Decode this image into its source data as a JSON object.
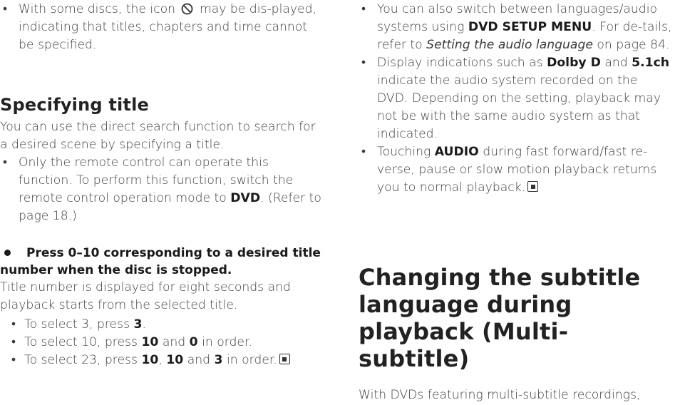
{
  "left": {
    "note_part1": "With some discs, the icon",
    "note_part2": "may be dis-played, indicating that titles, chapters and time cannot be specified.",
    "section_title": "Specifying title",
    "intro": "You can use the direct search function to search for a desired scene by specifying a title.",
    "remote_note_part1": "Only the remote control can operate this function. To perform this function, switch the remote control operation mode to",
    "remote_note_mode": "DVD",
    "remote_note_part2": ". (Refer to page 18.)",
    "step": "Press 0–10 corresponding to a desired title number when the disc is stopped.",
    "step_detail": "Title number is displayed for eight seconds and playback starts from the selected title.",
    "examples": {
      "ex1_text": "To select 3, press",
      "ex1_key": "3",
      "ex2_text": "To select 10, press",
      "ex2_key1": "10",
      "ex2_and": "and",
      "ex2_key2": "0",
      "ex2_tail": "in order.",
      "ex3_text": "To select 23, press",
      "ex3_key1": "10",
      "ex3_key2": "10",
      "ex3_and": "and",
      "ex3_key3": "3",
      "ex3_tail": "in order."
    }
  },
  "right": {
    "b1_part1": "You can also switch between languages/audio systems using",
    "b1_bold": "DVD SETUP MENU",
    "b1_part2": ". For de-tails, refer to",
    "b1_italic": "Setting the audio language",
    "b1_part3": "on page 84.",
    "b2_part1": "Display indications such as",
    "b2_bold1": "Dolby D",
    "b2_and": "and",
    "b2_bold2": "5.1ch",
    "b2_part2": "indicate the audio system recorded on the DVD. Depending on the setting, playback may not be with the same audio system as that indicated.",
    "b3_part1": "Touching",
    "b3_bold": "AUDIO",
    "b3_part2": "during fast forward/fast re-verse, pause or slow motion playback returns you to normal playback.",
    "section_title": "Changing the subtitle language during playback (Multi-subtitle)",
    "intro": "With DVDs featuring multi-subtitle recordings,"
  },
  "icons": [
    "prohibit-icon",
    "end-mark-icon",
    "step-bullet-icon"
  ]
}
